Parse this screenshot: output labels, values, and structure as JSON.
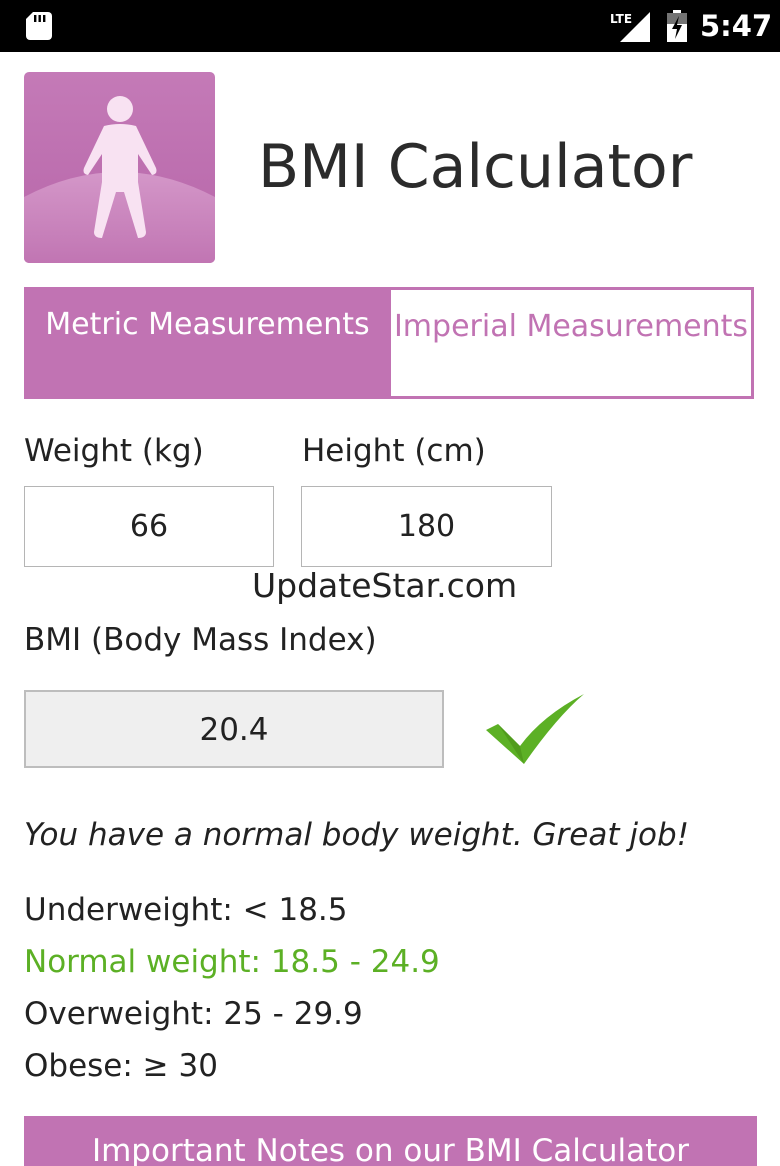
{
  "status_bar": {
    "network": "LTE",
    "time": "5:47"
  },
  "app": {
    "title": "BMI Calculator",
    "logo_icon": "person-icon",
    "accent_color": "#c173b3"
  },
  "tabs": {
    "metric_label": "Metric Measurements",
    "imperial_label": "Imperial Measurements",
    "active": "metric"
  },
  "inputs": {
    "weight_label": "Weight (kg)",
    "weight_value": "66",
    "height_label": "Height (cm)",
    "height_value": "180"
  },
  "watermark": "UpdateStar.com",
  "result": {
    "label": "BMI (Body Mass Index)",
    "value": "20.4",
    "status_icon": "checkmark-icon",
    "status_color": "#5cb025",
    "message": "You have a normal body weight. Great job!"
  },
  "ranges": [
    {
      "text": "Underweight: < 18.5",
      "active": false
    },
    {
      "text": "Normal weight: 18.5 - 24.9",
      "active": true
    },
    {
      "text": "Overweight: 25 - 29.9",
      "active": false
    },
    {
      "text": "Obese: ≥ 30",
      "active": false
    }
  ],
  "notes_button": {
    "label": "Important Notes on our BMI Calculator"
  }
}
